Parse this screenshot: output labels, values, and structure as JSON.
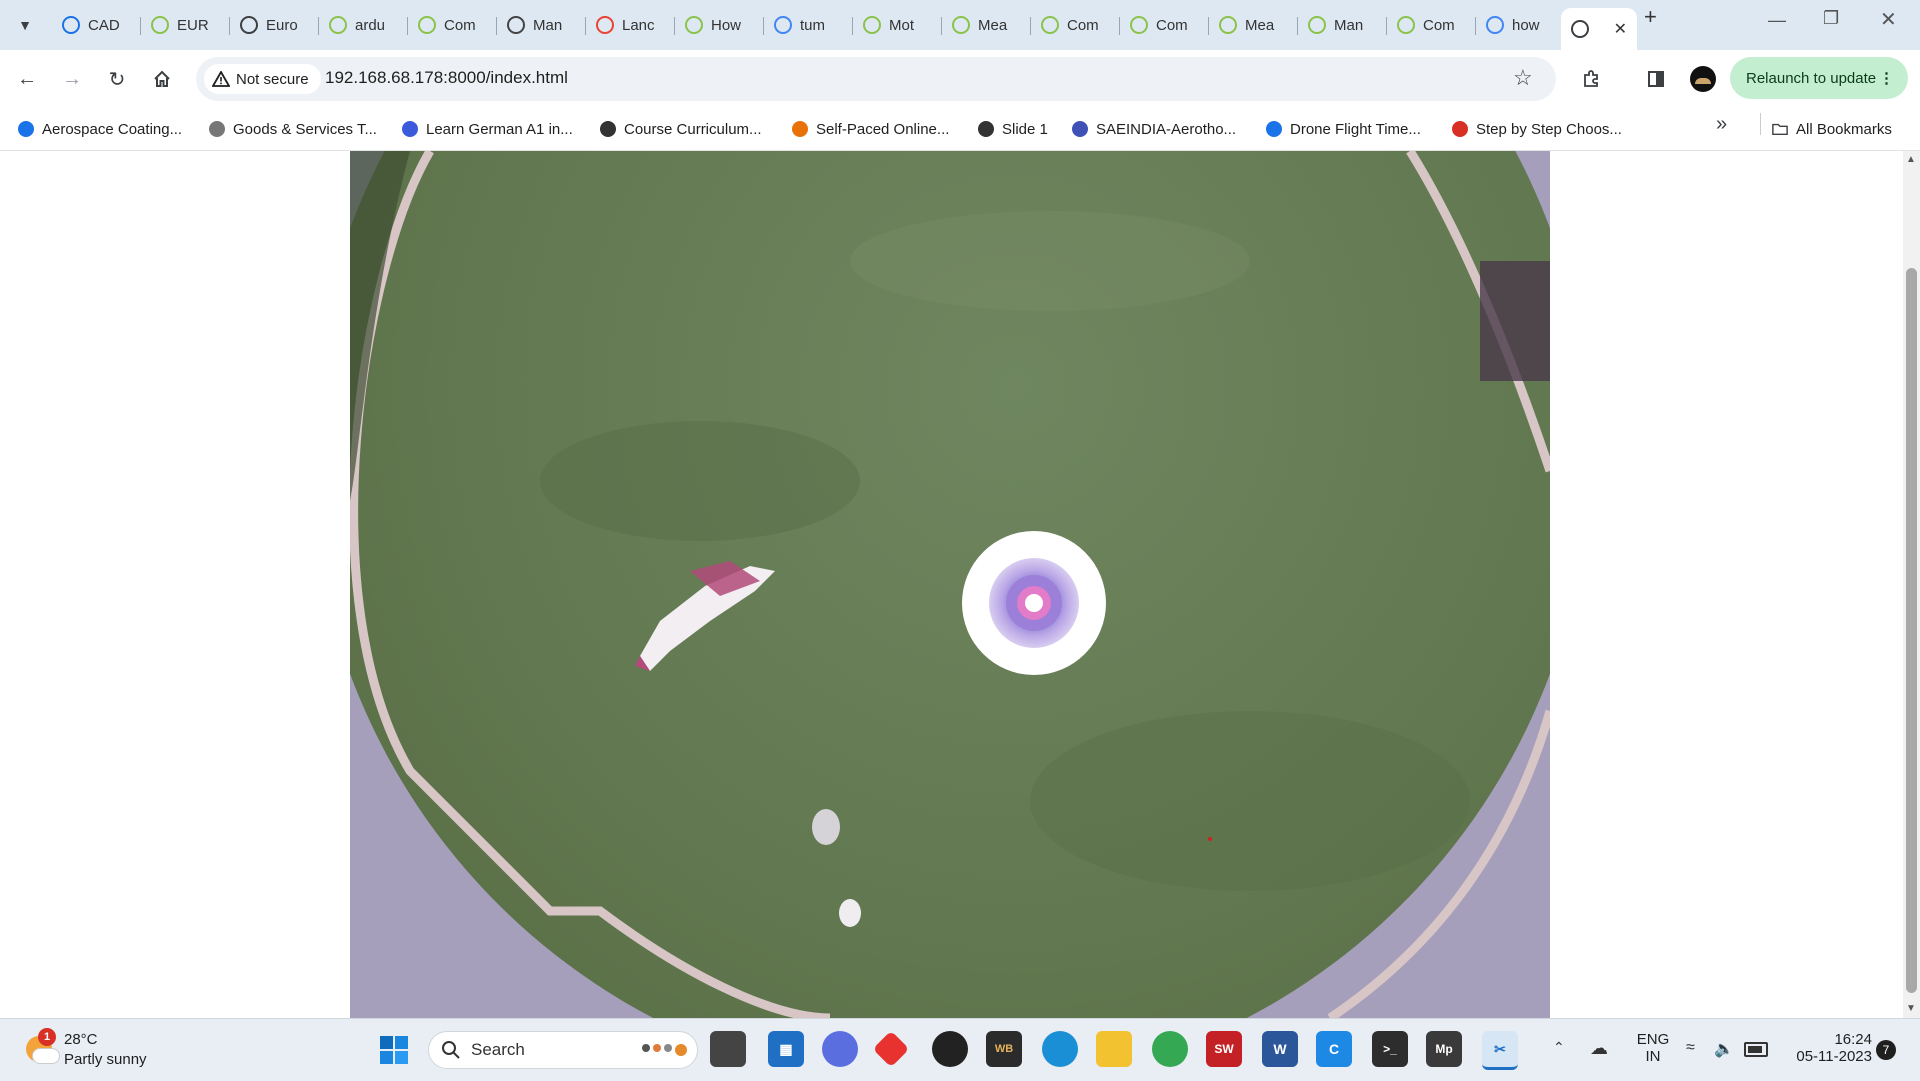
{
  "browser": {
    "tabs": [
      {
        "label": "CAD",
        "icon": "google-drive-icon"
      },
      {
        "label": "EUR",
        "icon": "tab-favicon"
      },
      {
        "label": "Euro",
        "icon": "globe-icon"
      },
      {
        "label": "ardu",
        "icon": "tab-favicon"
      },
      {
        "label": "Com",
        "icon": "tab-favicon"
      },
      {
        "label": "Man",
        "icon": "chatgpt-icon"
      },
      {
        "label": "Lanc",
        "icon": "gmail-icon"
      },
      {
        "label": "How",
        "icon": "tab-favicon"
      },
      {
        "label": "tum",
        "icon": "google-icon"
      },
      {
        "label": "Mot",
        "icon": "tab-favicon"
      },
      {
        "label": "Mea",
        "icon": "tab-favicon"
      },
      {
        "label": "Com",
        "icon": "tab-favicon"
      },
      {
        "label": "Com",
        "icon": "tab-favicon"
      },
      {
        "label": "Mea",
        "icon": "tab-favicon"
      },
      {
        "label": "Man",
        "icon": "tab-favicon"
      },
      {
        "label": "Com",
        "icon": "tab-favicon"
      },
      {
        "label": "how",
        "icon": "google-icon"
      },
      {
        "label": "",
        "icon": "globe-icon",
        "active": true
      }
    ],
    "security_label": "Not secure",
    "url": "192.168.68.178:8000/index.html",
    "relaunch_label": "Relaunch to update"
  },
  "bookmarks": {
    "items": [
      {
        "label": "Aerospace Coating..."
      },
      {
        "label": "Goods & Services T..."
      },
      {
        "label": "Learn German A1 in..."
      },
      {
        "label": "Course Curriculum..."
      },
      {
        "label": "Self-Paced Online..."
      },
      {
        "label": "Slide 1"
      },
      {
        "label": "SAEINDIA-Aerotho..."
      },
      {
        "label": "Drone Flight Time..."
      },
      {
        "label": "Step by Step Choos..."
      }
    ],
    "all_bookmarks_label": "All Bookmarks"
  },
  "taskbar": {
    "weather_temp": "28°C",
    "weather_desc": "Partly sunny",
    "weather_badge": "1",
    "search_placeholder": "Search",
    "lang_line1": "ENG",
    "lang_line2": "IN",
    "time": "16:24",
    "date": "05-11-2023",
    "notification_count": "7"
  },
  "colors": {
    "tabstrip": "#dee8f2",
    "grass": "#61774f",
    "relaunch": "#c4eed0"
  }
}
